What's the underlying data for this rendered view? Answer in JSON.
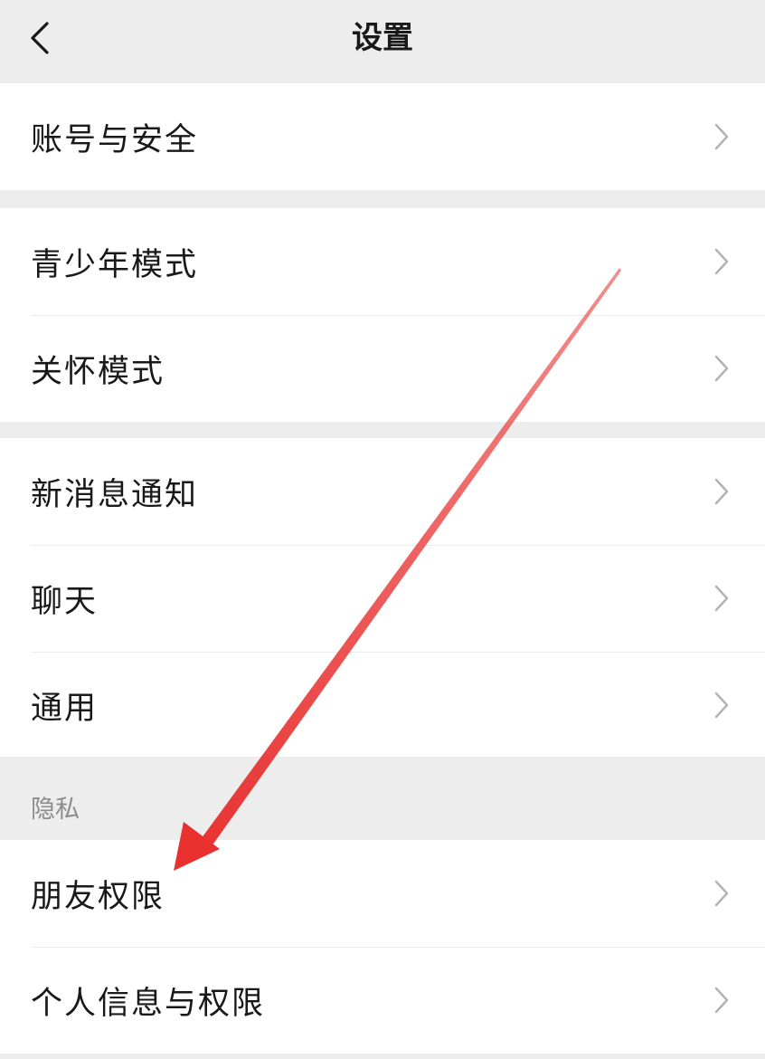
{
  "nav": {
    "title": "设置",
    "back_icon": "chevron-left-icon"
  },
  "groups": [
    {
      "items": [
        {
          "label": "账号与安全"
        }
      ]
    },
    {
      "items": [
        {
          "label": "青少年模式"
        },
        {
          "label": "关怀模式"
        }
      ]
    },
    {
      "items": [
        {
          "label": "新消息通知"
        },
        {
          "label": "聊天"
        },
        {
          "label": "通用"
        }
      ]
    }
  ],
  "privacy_section": {
    "header": "隐私",
    "items": [
      {
        "label": "朋友权限"
      },
      {
        "label": "个人信息与权限"
      }
    ]
  },
  "row_chevron_icon": "chevron-right-icon",
  "annotation": {
    "arrow_color": "#e8302f",
    "points_to": "朋友权限"
  },
  "colors": {
    "background": "#ededed",
    "card": "#ffffff",
    "text_primary": "#191919",
    "text_secondary": "#8c8c8c",
    "chevron": "#b2b2b2"
  }
}
